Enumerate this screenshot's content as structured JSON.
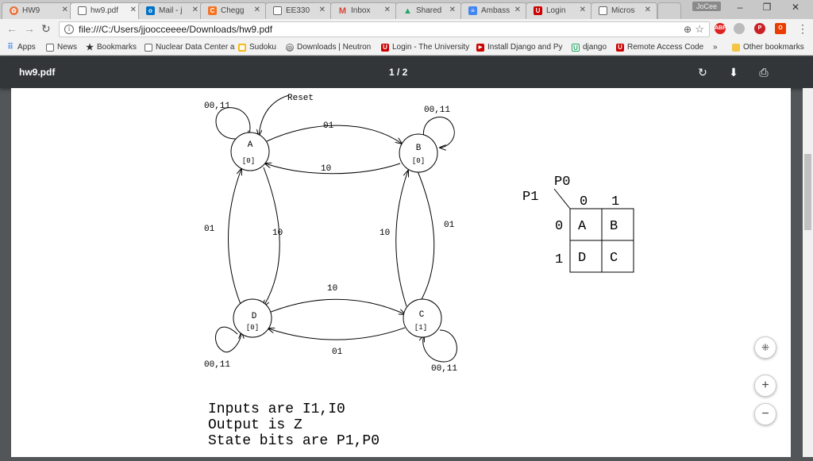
{
  "tabs": [
    {
      "label": "HW9",
      "icon": "hw9-icon",
      "icon_color": "#e8743b",
      "active": false
    },
    {
      "label": "hw9.pdf",
      "icon": "document-icon",
      "icon_color": "#ffffff",
      "active": true
    },
    {
      "label": "Mail - j",
      "icon": "outlook-icon",
      "icon_color": "#0072c6",
      "active": false
    },
    {
      "label": "Chegg",
      "icon": "chegg-icon",
      "icon_color": "#f47321",
      "active": false
    },
    {
      "label": "EE330",
      "icon": "document-icon",
      "icon_color": "#ffffff",
      "active": false
    },
    {
      "label": "Inbox",
      "icon": "gmail-icon",
      "icon_color": "#d44638",
      "active": false
    },
    {
      "label": "Shared",
      "icon": "drive-icon",
      "icon_color": "#1fa463",
      "active": false
    },
    {
      "label": "Ambass",
      "icon": "docs-icon",
      "icon_color": "#4285f4",
      "active": false
    },
    {
      "label": "Login",
      "icon": "utah-icon",
      "icon_color": "#cc0000",
      "active": false
    },
    {
      "label": "Micros",
      "icon": "document-icon",
      "icon_color": "#ffffff",
      "active": false
    }
  ],
  "profile_name": "JoCee",
  "address": "file:///C:/Users/jjoocceeee/Downloads/hw9.pdf",
  "bookmarks": [
    {
      "label": "Apps",
      "icon": "apps-grid-icon",
      "color": "#4285f4"
    },
    {
      "label": "News",
      "icon": "document-icon",
      "color": "#ffffff"
    },
    {
      "label": "Bookmarks",
      "icon": "star-icon",
      "color": "#333333"
    },
    {
      "label": "Nuclear Data Center a",
      "icon": "document-icon",
      "color": "#ffffff"
    },
    {
      "label": "Sudoku",
      "icon": "sudoku-icon",
      "color": "#f4b400"
    },
    {
      "label": "Downloads | Neutron",
      "icon": "neutron-icon",
      "color": "#777777"
    },
    {
      "label": "Login - The University",
      "icon": "utah-icon",
      "color": "#cc0000"
    },
    {
      "label": "Install Django and Py",
      "icon": "youtube-icon",
      "color": "#cc0000"
    },
    {
      "label": "django",
      "icon": "django-u-icon",
      "color": "#1fa463"
    },
    {
      "label": "Remote Access Code",
      "icon": "utah-icon",
      "color": "#cc0000"
    }
  ],
  "other_bookmarks": "Other bookmarks",
  "more_bookmarks": "»",
  "pdf": {
    "title": "hw9.pdf",
    "page_indicator": "1 / 2"
  },
  "fsm": {
    "reset_label": "Reset",
    "states": [
      {
        "name": "A",
        "output": "[0]"
      },
      {
        "name": "B",
        "output": "[0]"
      },
      {
        "name": "C",
        "output": "[1]"
      },
      {
        "name": "D",
        "output": "[0]"
      }
    ],
    "self_loops": {
      "A": "00,11",
      "B": "00,11",
      "C": "00,11",
      "D": "00,11"
    },
    "transitions": {
      "A_to_B": "01",
      "B_to_A": "10",
      "A_to_D": "10",
      "D_to_A": "01",
      "B_to_C": "01",
      "C_to_B": "10",
      "D_to_C": "10",
      "C_to_D": "01"
    }
  },
  "state_table": {
    "col_var": "P0",
    "row_var": "P1",
    "col_headers": [
      "0",
      "1"
    ],
    "row_headers": [
      "0",
      "1"
    ],
    "cells": [
      [
        "A",
        "B"
      ],
      [
        "D",
        "C"
      ]
    ]
  },
  "notes": [
    "Inputs are I1,I0",
    "Output is Z",
    "State bits are P1,P0"
  ]
}
